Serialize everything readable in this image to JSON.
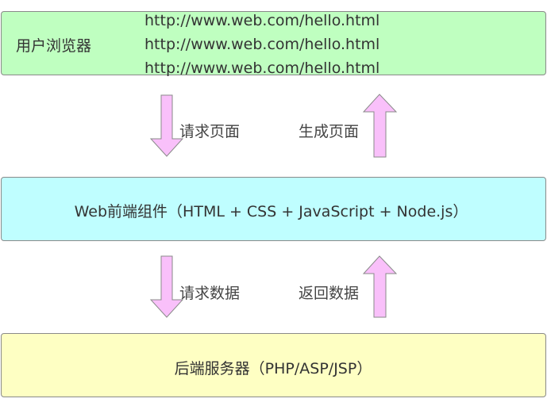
{
  "layers": {
    "browser": {
      "label": "用户浏览器",
      "urls": [
        "http://www.web.com/hello.html",
        "http://www.web.com/hello.html",
        "http://www.web.com/hello.html"
      ]
    },
    "frontend": {
      "label": "Web前端组件（HTML + CSS + JavaScript + Node.js）"
    },
    "backend": {
      "label": "后端服务器（PHP/ASP/JSP）"
    }
  },
  "arrows": {
    "request_page": "请求页面",
    "generate_page": "生成页面",
    "request_data": "请求数据",
    "return_data": "返回数据"
  },
  "colors": {
    "browser_fill": "#bfffc0",
    "frontend_fill": "#bffeff",
    "backend_fill": "#feffc3",
    "arrow_fill": "#f9c0fa",
    "border": "#8a8a8a"
  }
}
